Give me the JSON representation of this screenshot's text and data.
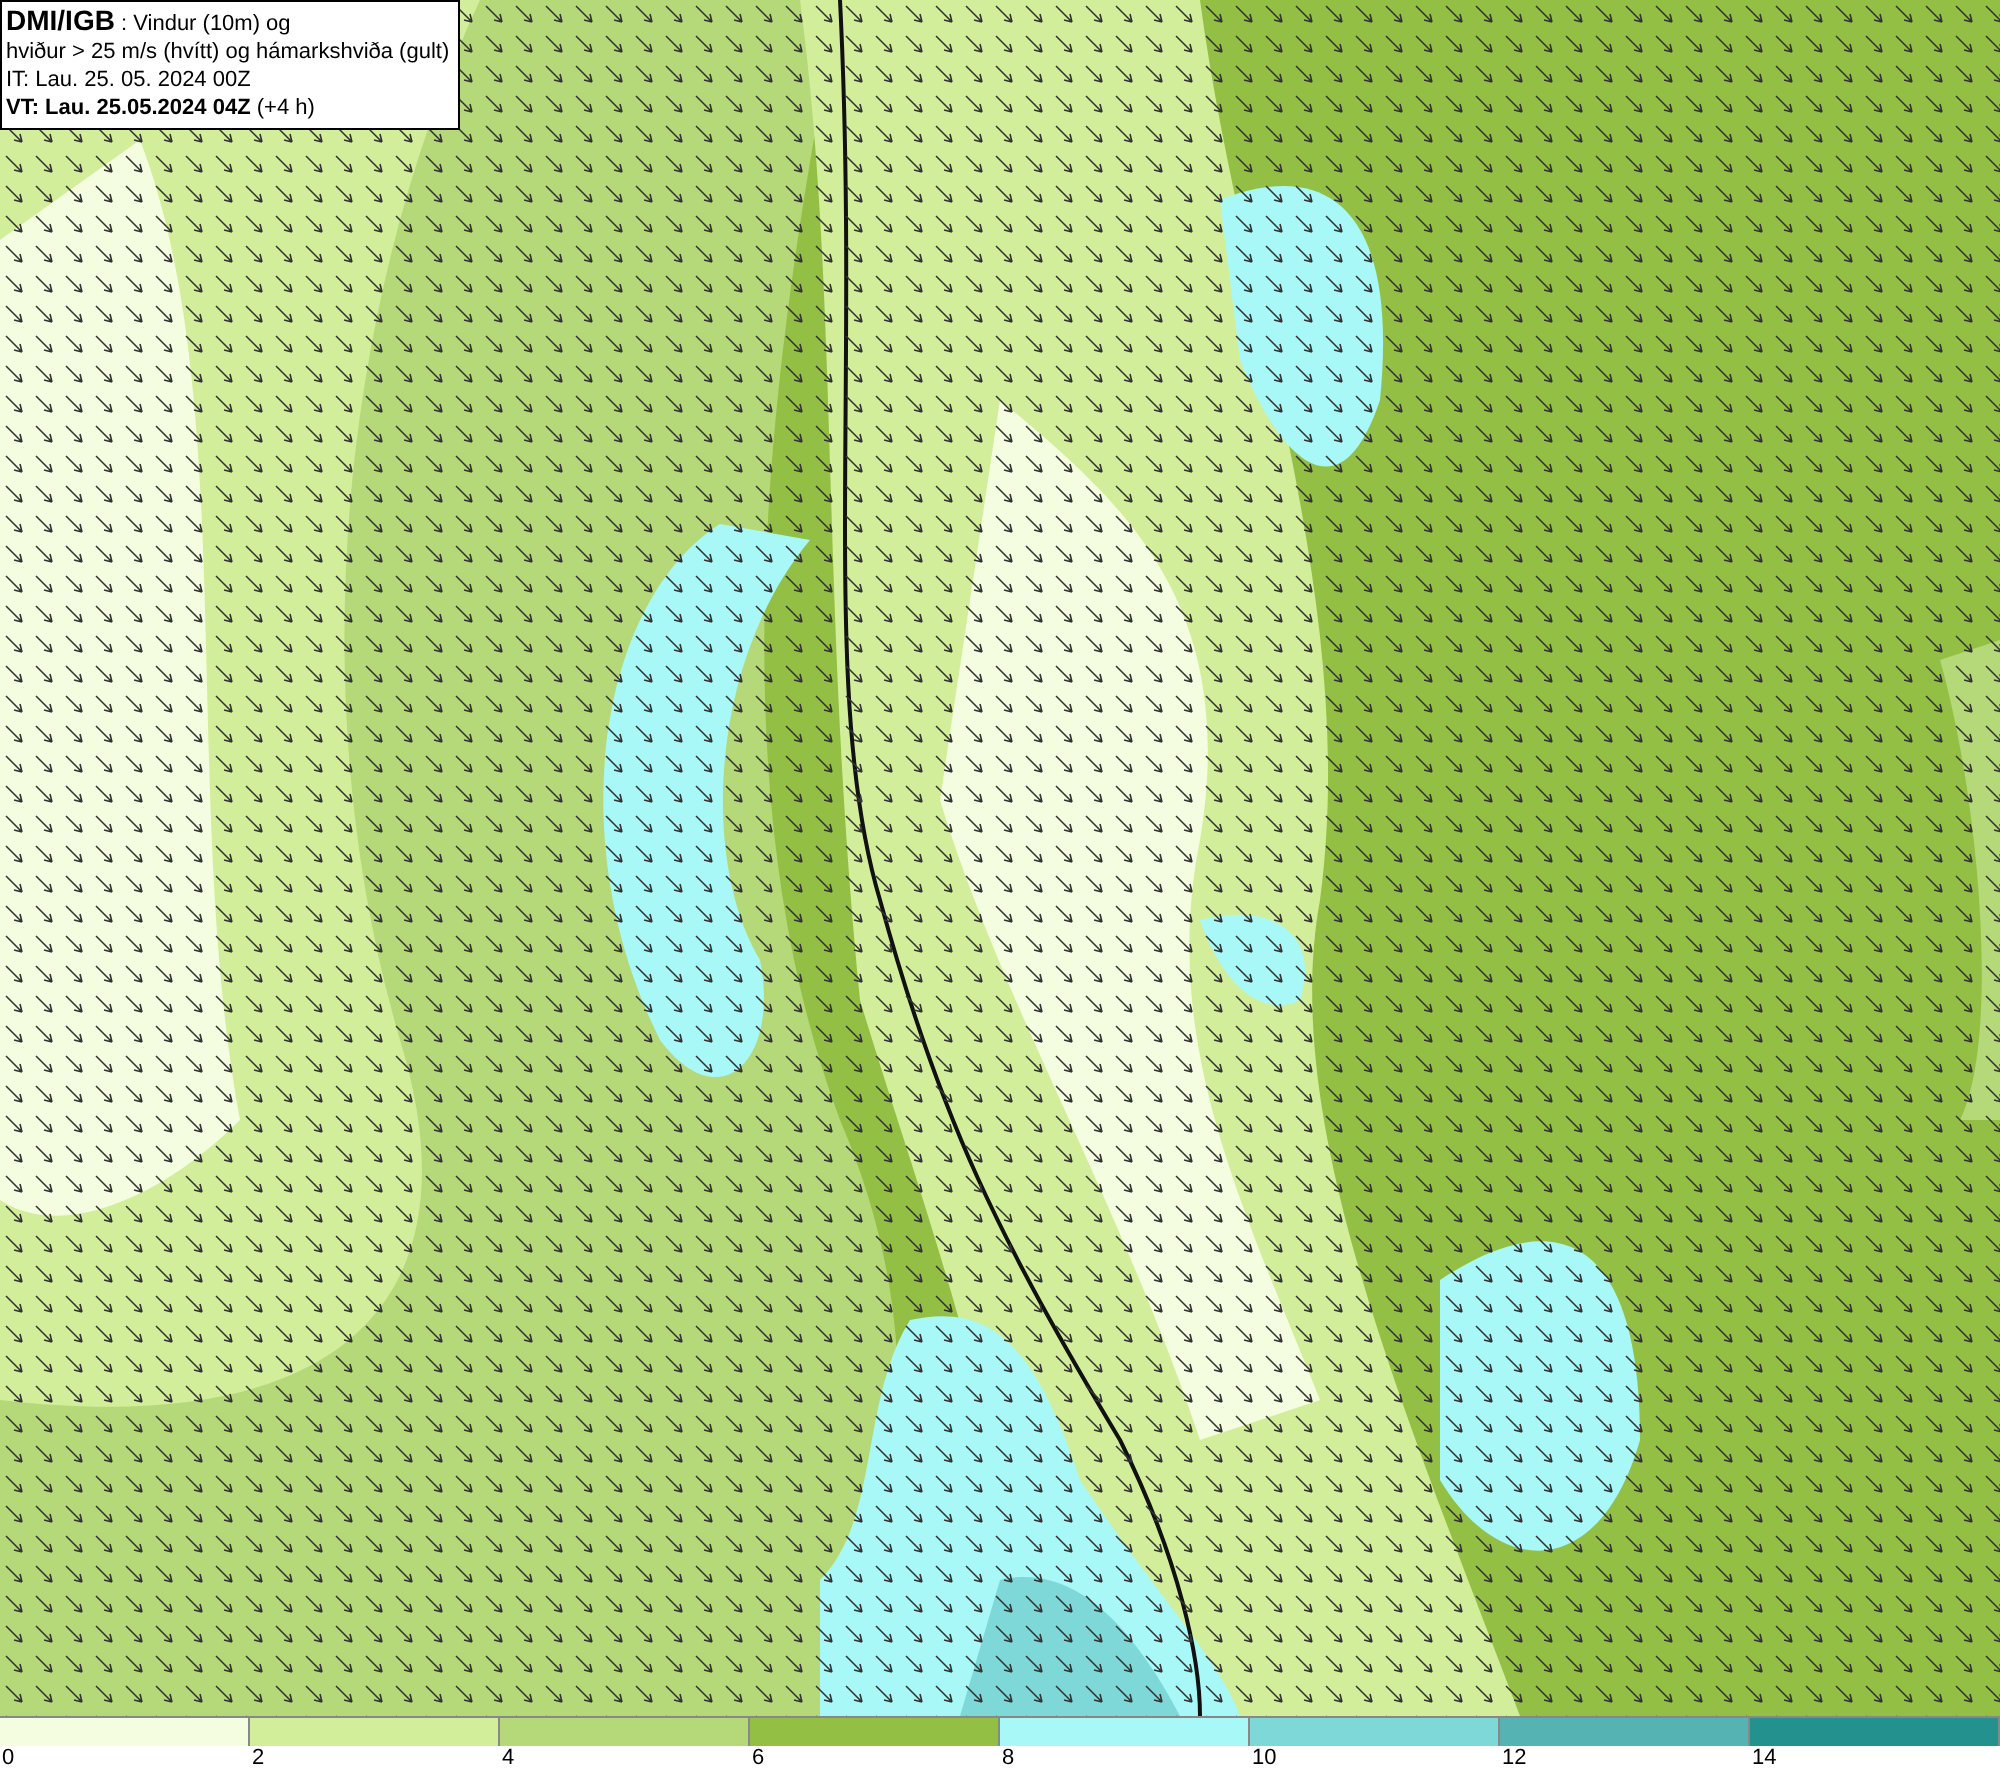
{
  "title_box": {
    "lines": [
      "**DMI/IGB** : Vindur (10m) og",
      "hviður > 25 m/s (hvítt) og hámarkshviða (gult)",
      "IT: Lau. 25. 05. 2024 00Z",
      "**VT: Lau. 25.05.2024 04Z** (+4 h)"
    ]
  },
  "legend": [
    {
      "label": "0",
      "color": "#f5fde0"
    },
    {
      "label": "2",
      "color": "#d3ee9a"
    },
    {
      "label": "4",
      "color": "#b5d978"
    },
    {
      "label": "6",
      "color": "#93bf45"
    },
    {
      "label": "8",
      "color": "#a8f8f8"
    },
    {
      "label": "10",
      "color": "#7fd8d8"
    },
    {
      "label": "12",
      "color": "#55b3b3"
    },
    {
      "label": "14",
      "color": "#23918e"
    }
  ]
}
